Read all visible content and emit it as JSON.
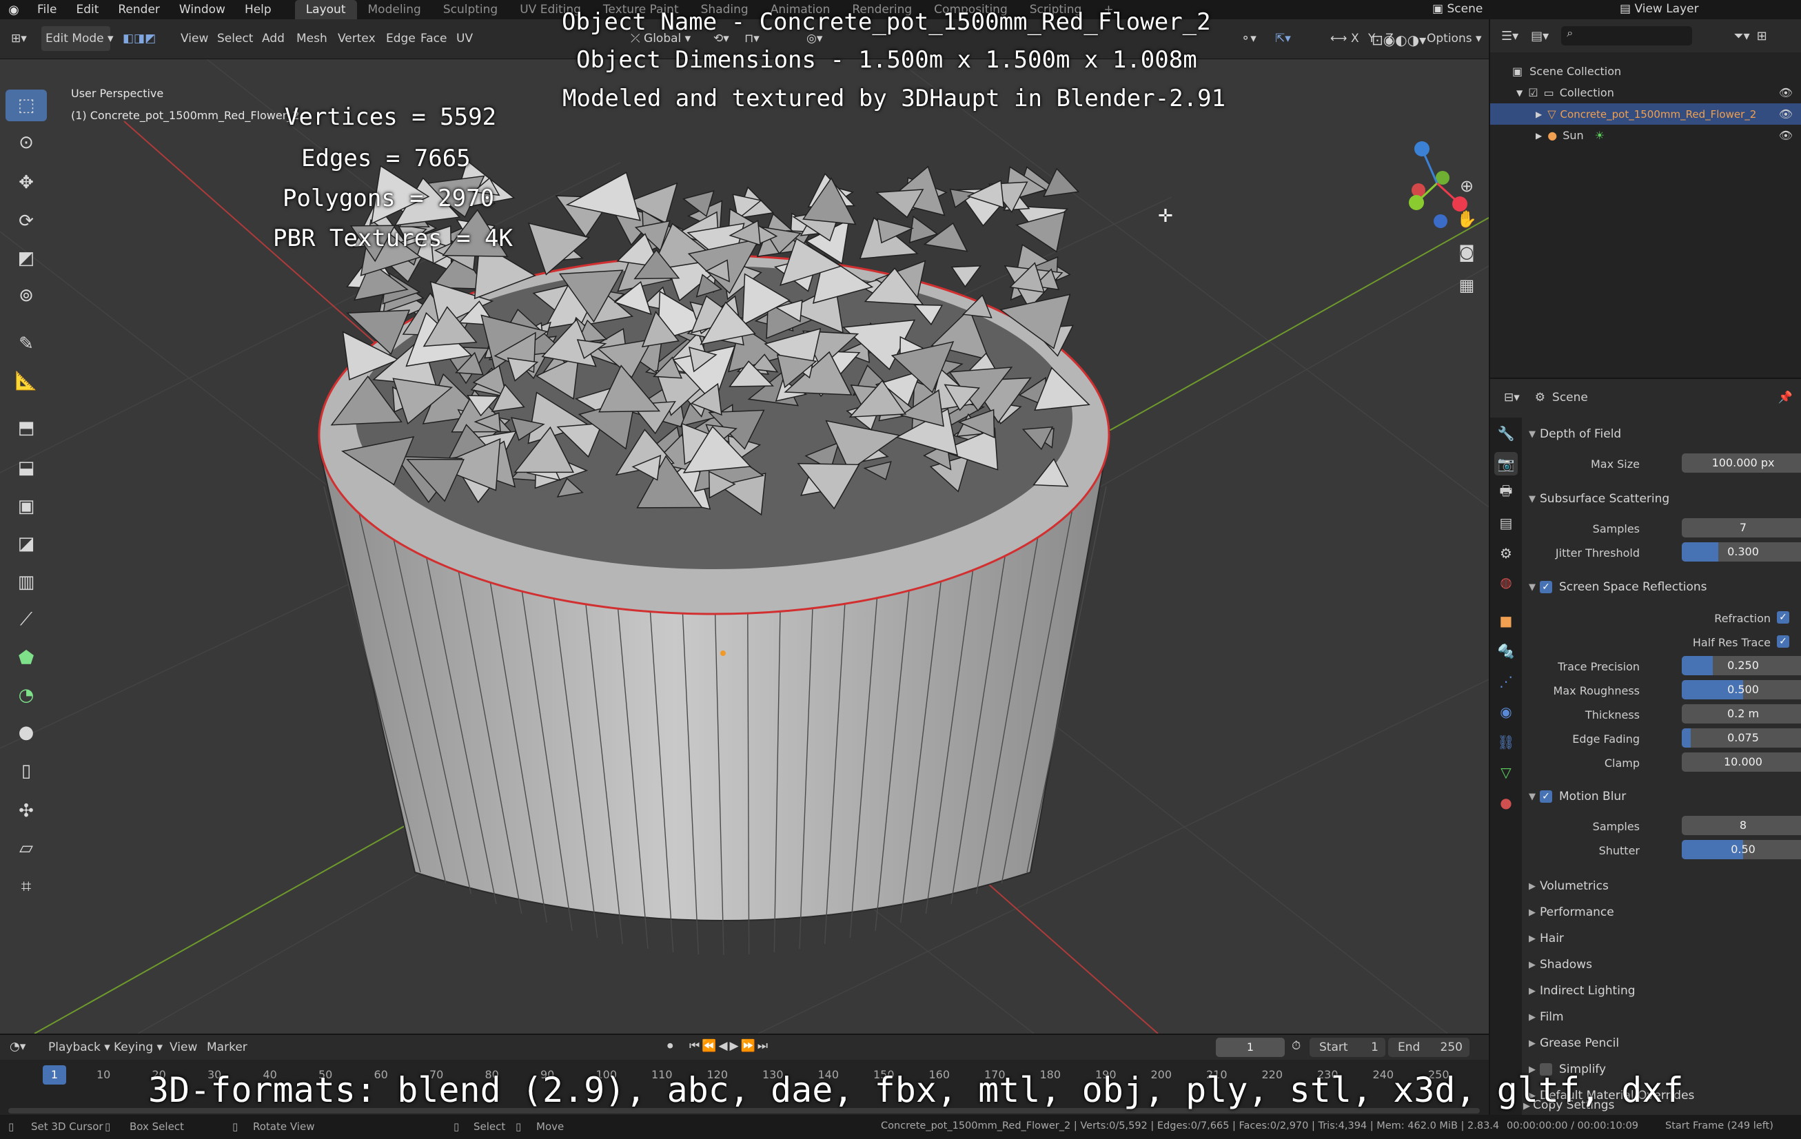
{
  "topbar": {
    "menus": [
      "File",
      "Edit",
      "Render",
      "Window",
      "Help"
    ],
    "workspaces": [
      "Layout",
      "Modeling",
      "Sculpting",
      "UV Editing",
      "Texture Paint",
      "Shading",
      "Animation",
      "Rendering",
      "Compositing",
      "Scripting"
    ],
    "add_tab": "+",
    "scene_label": "Scene",
    "view_layer_label": "View Layer"
  },
  "header3d": {
    "mode": "Edit Mode",
    "menus": [
      "View",
      "Select",
      "Add",
      "Mesh",
      "Vertex",
      "Edge",
      "Face",
      "UV"
    ],
    "transform_orientation": "Global",
    "axes": [
      "X",
      "Y",
      "Z"
    ],
    "options_label": "Options"
  },
  "viewport": {
    "view_name": "User Perspective",
    "object_label": "(1) Concrete_pot_1500mm_Red_Flower_2"
  },
  "overlay": {
    "stats": [
      "Vertices = 5592",
      "Edges = 7665",
      "Polygons = 2970",
      "PBR Textures = 4K"
    ],
    "title_lines": [
      "Object Name - Concrete_pot_1500mm_Red_Flower_2",
      "Object Dimensions -  1.500m x 1.500m x 1.008m",
      "Modeled and textured by 3DHaupt in Blender-2.91"
    ],
    "formats": "3D-formats: blend (2.9), abc, dae, fbx, mtl, obj, ply, stl, x3d, gltf, dxf"
  },
  "outliner": {
    "scene_collection": "Scene Collection",
    "collection": "Collection",
    "object": "Concrete_pot_1500mm_Red_Flower_2",
    "sun": "Sun"
  },
  "properties": {
    "context": "Scene",
    "dof": {
      "title": "Depth of Field",
      "max_size_label": "Max Size",
      "max_size": "100.000 px"
    },
    "sss": {
      "title": "Subsurface Scattering",
      "samples_label": "Samples",
      "samples": "7",
      "jitter_label": "Jitter Threshold",
      "jitter": "0.300",
      "jitter_frac": 0.3
    },
    "ssr": {
      "title": "Screen Space Reflections",
      "refraction_label": "Refraction",
      "half_res_label": "Half Res Trace",
      "trace_label": "Trace Precision",
      "trace": "0.250",
      "trace_frac": 0.25,
      "rough_label": "Max Roughness",
      "rough": "0.500",
      "rough_frac": 0.5,
      "thick_label": "Thickness",
      "thick": "0.2 m",
      "fade_label": "Edge Fading",
      "fade": "0.075",
      "fade_frac": 0.075,
      "clamp_label": "Clamp",
      "clamp": "10.000"
    },
    "mb": {
      "title": "Motion Blur",
      "samples_label": "Samples",
      "samples": "8",
      "shutter_label": "Shutter",
      "shutter": "0.50",
      "shutter_frac": 0.5
    },
    "collapsed": [
      "Volumetrics",
      "Performance",
      "Hair",
      "Shadows",
      "Indirect Lighting",
      "Film",
      "Grease Pencil",
      "Simplify",
      "Default Material Overrides",
      "Copy Settings"
    ]
  },
  "timeline": {
    "menus": [
      "Playback",
      "Keying",
      "View",
      "Marker"
    ],
    "current_frame": "1",
    "start_label": "Start",
    "start": "1",
    "end_label": "End",
    "end": "250",
    "ticks": [
      "10",
      "20",
      "30",
      "40",
      "50",
      "60",
      "70",
      "80",
      "90",
      "100",
      "110",
      "120",
      "130",
      "140",
      "150",
      "160",
      "170",
      "180",
      "190",
      "200",
      "210",
      "220",
      "230",
      "240",
      "250"
    ],
    "playhead": "1"
  },
  "statusbar": {
    "set_cursor": "Set 3D Cursor",
    "box_select": "Box Select",
    "rotate_view": "Rotate View",
    "select": "Select",
    "move": "Move",
    "stats": "Concrete_pot_1500mm_Red_Flower_2 | Verts:0/5,592 | Edges:0/7,665 | Faces:0/2,970 | Tris:4,394 | Mem: 462.0 MiB | 2.83.4",
    "time": "00:00:00:00 / 00:00:10:09",
    "start_frame": "Start Frame (249 left)"
  }
}
